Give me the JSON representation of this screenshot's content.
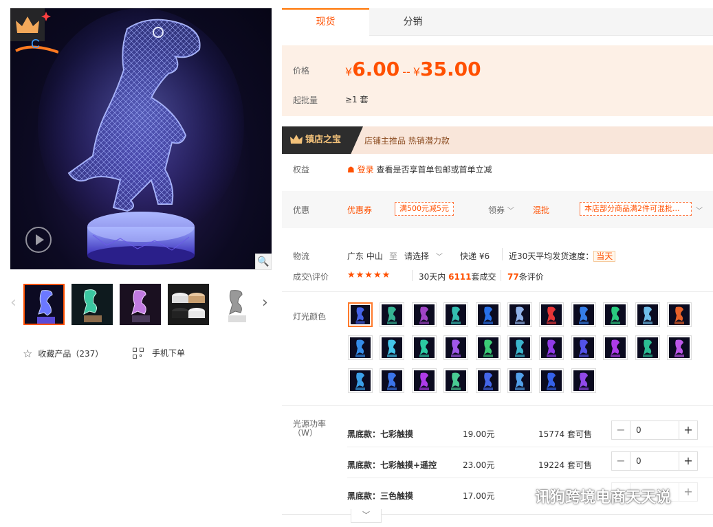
{
  "gallery": {
    "thumbnails": [
      {
        "name": "blue-dino",
        "selected": true
      },
      {
        "name": "teal-dino",
        "selected": false
      },
      {
        "name": "purple-dino",
        "selected": false
      },
      {
        "name": "bases",
        "selected": false
      },
      {
        "name": "white-dino",
        "selected": false
      }
    ],
    "favorite_label": "收藏产品（237）",
    "mobile_label": "手机下单"
  },
  "tabs": [
    {
      "label": "现货",
      "active": true
    },
    {
      "label": "分销",
      "active": false
    }
  ],
  "price": {
    "label": "价格",
    "currency": "¥",
    "low": "6.00",
    "high": "35.00",
    "dash": "--",
    "moq_label": "起批量",
    "moq_value": "≥1 套"
  },
  "treasure": {
    "badge": "镇店之宝",
    "text": "店铺主推品  热销潜力款"
  },
  "benefits": {
    "label": "权益",
    "login": "登录",
    "text": "查看是否享首单包邮或首单立减"
  },
  "promo": {
    "label": "优惠",
    "coupon_title": "优惠券",
    "coupon_tag": "满500元减5元",
    "claim": "领券",
    "mix_title": "混批",
    "mix_tag": "本店部分商品满2件可混批..."
  },
  "logistics": {
    "label": "物流",
    "from": "广东 中山",
    "to_word": "至",
    "select": "请选择",
    "express": "快递 ¥6",
    "speed_label": "近30天平均发货速度：",
    "speed_value": "当天"
  },
  "deals": {
    "label": "成交\\评价",
    "stars": "★★★★★",
    "prefix": "30天内",
    "count": "6111",
    "suffix": "套成交",
    "reviews": "77",
    "reviews_suffix": "条评价"
  },
  "colors": {
    "label": "灯光颜色",
    "swatches": [
      "#4a6bff",
      "#3bc7a0",
      "#b04ad8",
      "#38d0c0",
      "#2a7bff",
      "#a0c4ff",
      "#ff3a3a",
      "#3a8bff",
      "#2ee08a",
      "#7ad0ff",
      "#ff6a2a",
      "#3a9bff",
      "#4ad8ff",
      "#2fe0b0",
      "#b060ff",
      "#40e080",
      "#40c8e0",
      "#a040ff",
      "#5a5aff",
      "#c040ff",
      "#30d0a0",
      "#d060ff",
      "#40b0ff",
      "#4080ff",
      "#c040ff",
      "#50e0a0",
      "#4a70ff",
      "#5ab0ff",
      "#3a6aff",
      "#a050ff"
    ]
  },
  "power": {
    "label": "光源功率",
    "unit": "（W）",
    "rows": [
      {
        "name": "黑底款：七彩触摸",
        "price": "19.00元",
        "stock": "15774 套可售",
        "qty": "0"
      },
      {
        "name": "黑底款：七彩触摸+遥控",
        "price": "23.00元",
        "stock": "19224 套可售",
        "qty": "0"
      },
      {
        "name": "黑底款：三色触摸",
        "price": "17.00元",
        "stock": "",
        "qty": ""
      }
    ]
  },
  "watermark": "讯狗跨境电商天天说",
  "expand_icon": "chevron-down-icon"
}
